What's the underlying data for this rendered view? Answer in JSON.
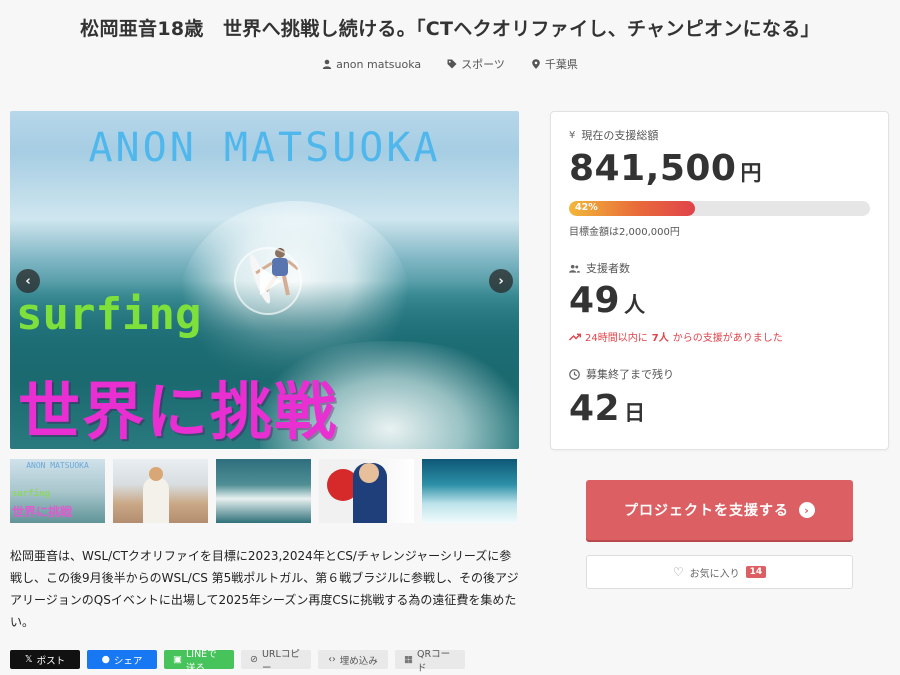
{
  "title": "松岡亜音18歳　世界へ挑戦し続ける。「CTヘクオリファイし、チャンピオンになる」",
  "meta": {
    "owner": "anon matsuoka",
    "category": "スポーツ",
    "location": "千葉県"
  },
  "hero": {
    "banner_top": "ANON MATSUOKA",
    "banner_surf": "surfing",
    "banner_jp": "世界に挑戦",
    "prev_icon": "‹",
    "next_icon": "›"
  },
  "thumbnails": {
    "t1_top": "ANON MATSUOKA",
    "t1_mid": "surfing",
    "t1_bottom": "世界に挑戦"
  },
  "description": "松岡亜音は、WSL/CTクオリファイを目標に2023,2024年とCS/チャレンジャーシリーズに参戦し、この後9月後半からのWSL/CS 第5戦ポルトガル、第６戦ブラジルに参戦し、その後アジアリージョンのQSイベントに出場して2025年シーズン再度CSに挑戦する為の遠征費を集めたい。",
  "share": {
    "x": "ポスト",
    "facebook": "シェア",
    "line": "LINEで送る",
    "url": "URLコピー",
    "embed": "埋め込み",
    "qr": "QRコード"
  },
  "stats": {
    "total_label": "現在の支援総額",
    "total_value": "841,500",
    "total_unit": "円",
    "progress_percent_label": "42%",
    "progress_percent": 42,
    "goal_text": "目標金額は2,000,000円",
    "supporters_label": "支援者数",
    "supporters_value": "49",
    "supporters_unit": "人",
    "trend_prefix": "24時間以内に",
    "trend_count": "7人",
    "trend_suffix": "からの支援がありました",
    "remaining_label": "募集終了まで残り",
    "remaining_value": "42",
    "remaining_unit": "日"
  },
  "actions": {
    "support_label": "プロジェクトを支援する",
    "favorite_label": "お気に入り",
    "favorite_count": "14"
  },
  "colors": {
    "accent": "#dc5f63",
    "trend": "#e0434a",
    "line": "#46c35a",
    "facebook": "#1877f2"
  }
}
